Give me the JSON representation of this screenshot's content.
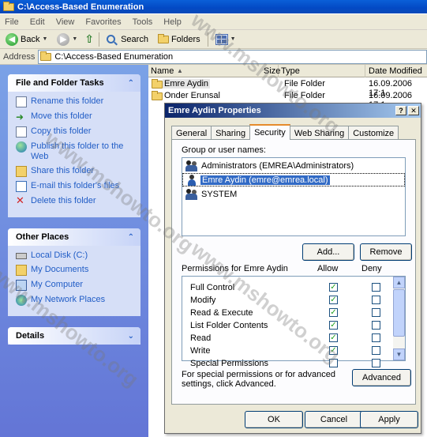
{
  "window": {
    "title": "C:\\Access-Based Enumeration"
  },
  "menu": [
    "File",
    "Edit",
    "View",
    "Favorites",
    "Tools",
    "Help"
  ],
  "toolbar": {
    "back": "Back",
    "search": "Search",
    "folders": "Folders"
  },
  "address": {
    "label": "Address",
    "value": "C:\\Access-Based Enumeration"
  },
  "tasks": {
    "file_folder": {
      "title": "File and Folder Tasks",
      "items": [
        "Rename this folder",
        "Move this folder",
        "Copy this folder",
        "Publish this folder to the Web",
        "Share this folder",
        "E-mail this folder's files",
        "Delete this folder"
      ]
    },
    "other_places": {
      "title": "Other Places",
      "items": [
        "Local Disk (C:)",
        "My Documents",
        "My Computer",
        "My Network Places"
      ]
    },
    "details": {
      "title": "Details"
    }
  },
  "filelist": {
    "columns": [
      "Name",
      "Size",
      "Type",
      "Date Modified"
    ],
    "rows": [
      {
        "name": "Emre Aydin",
        "size": "",
        "type": "File Folder",
        "date": "16.09.2006 17:1"
      },
      {
        "name": "Onder Erunsal",
        "size": "",
        "type": "File Folder",
        "date": "16.09.2006 17:1"
      }
    ]
  },
  "dialog": {
    "title": "Emre Aydin Properties",
    "tabs": [
      "General",
      "Sharing",
      "Security",
      "Web Sharing",
      "Customize"
    ],
    "active_tab": "Security",
    "group_label": "Group or user names:",
    "users": [
      {
        "name": "Administrators (EMREA\\Administrators)",
        "icon": "group-icon"
      },
      {
        "name": "Emre Aydin (emre@emrea.local)",
        "icon": "user-icon",
        "selected": true
      },
      {
        "name": "SYSTEM",
        "icon": "group-icon"
      }
    ],
    "add_button": "Add...",
    "remove_button": "Remove",
    "perm_label": "Permissions for Emre Aydin",
    "allow_label": "Allow",
    "deny_label": "Deny",
    "permissions": [
      {
        "name": "Full Control",
        "allow": true,
        "deny": false
      },
      {
        "name": "Modify",
        "allow": true,
        "deny": false
      },
      {
        "name": "Read & Execute",
        "allow": true,
        "deny": false
      },
      {
        "name": "List Folder Contents",
        "allow": true,
        "deny": false
      },
      {
        "name": "Read",
        "allow": true,
        "deny": false
      },
      {
        "name": "Write",
        "allow": true,
        "deny": false
      },
      {
        "name": "Special Permissions",
        "allow": false,
        "deny": false
      }
    ],
    "special_text": "For special permissions or for advanced settings, click Advanced.",
    "advanced_button": "Advanced",
    "ok_button": "OK",
    "cancel_button": "Cancel",
    "apply_button": "Apply"
  },
  "watermark": "www.mshowto.org"
}
